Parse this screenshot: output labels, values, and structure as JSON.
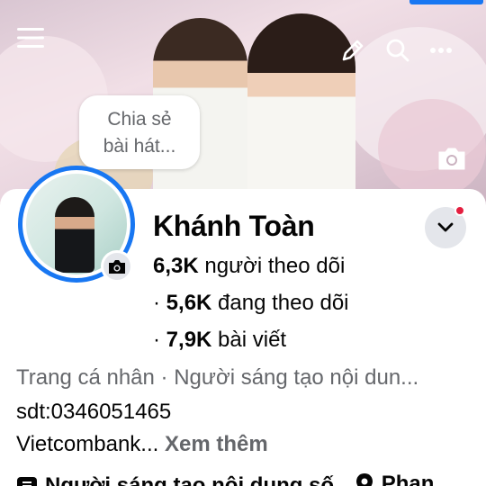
{
  "cover": {
    "bubble_text_line1": "Chia sẻ",
    "bubble_text_line2": "bài hát...",
    "icons": [
      "menu-icon",
      "edit-icon",
      "search-icon",
      "more-icon",
      "camera-icon"
    ]
  },
  "profile": {
    "name": "Khánh Toàn",
    "followers_count": "6,3K",
    "followers_label": "người theo dõi",
    "following_count": "5,6K",
    "following_label": "đang theo dõi",
    "posts_count": "7,9K",
    "posts_label": "bài viết",
    "category": "Trang cá nhân · Người sáng tạo nội dun...",
    "bio_phone": "sdt:0346051465",
    "bio_bank": "Vietcombank...",
    "see_more": "Xem thêm"
  },
  "badges": [
    {
      "icon": "creator-badge-icon",
      "label": "Người sáng tạo nội dung số"
    },
    {
      "icon": "location-icon",
      "label": "Phan"
    }
  ],
  "colors": {
    "accent": "#1877f2",
    "notification": "#e41e3f",
    "secondary_text": "#65676b",
    "button_bg": "#e4e6eb"
  }
}
